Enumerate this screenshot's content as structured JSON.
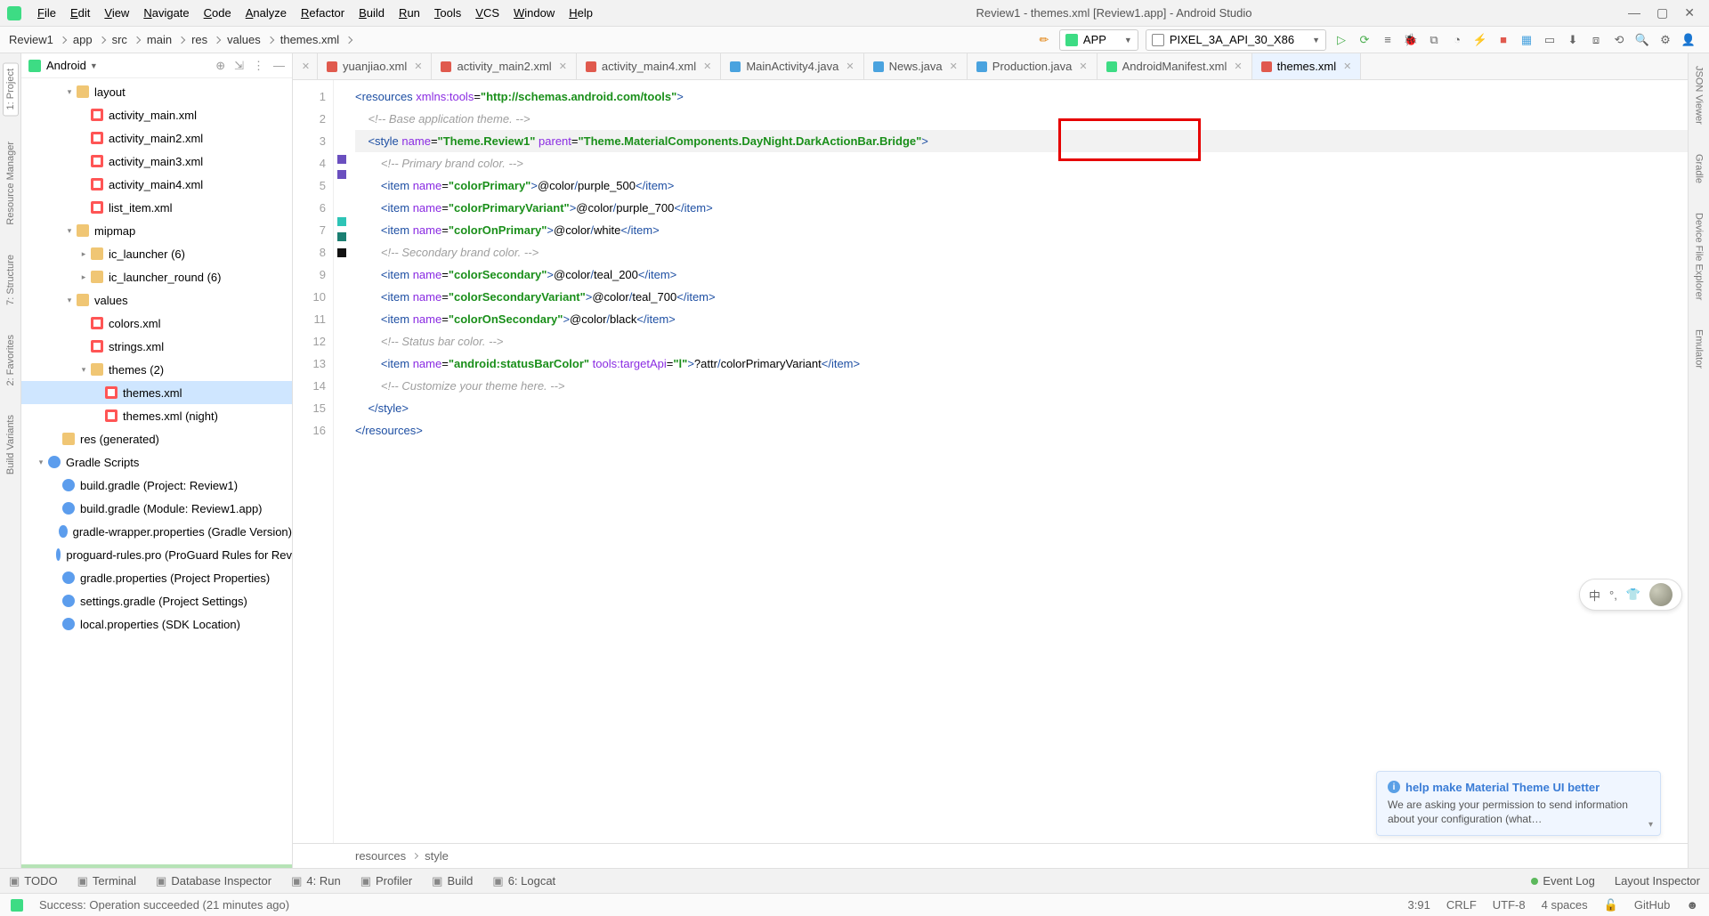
{
  "menu": [
    "File",
    "Edit",
    "View",
    "Navigate",
    "Code",
    "Analyze",
    "Refactor",
    "Build",
    "Run",
    "Tools",
    "VCS",
    "Window",
    "Help"
  ],
  "window_title": "Review1 - themes.xml [Review1.app] - Android Studio",
  "breadcrumbs": [
    "Review1",
    "app",
    "src",
    "main",
    "res",
    "values",
    "themes.xml"
  ],
  "run_config": {
    "app": "APP",
    "device": "PIXEL_3A_API_30_X86"
  },
  "project_panel": {
    "title": "Android",
    "tree": [
      {
        "d": 3,
        "t": "folder",
        "label": "layout",
        "expand": "▾"
      },
      {
        "d": 4,
        "t": "xml",
        "label": "activity_main.xml"
      },
      {
        "d": 4,
        "t": "xml",
        "label": "activity_main2.xml"
      },
      {
        "d": 4,
        "t": "xml",
        "label": "activity_main3.xml"
      },
      {
        "d": 4,
        "t": "xml",
        "label": "activity_main4.xml"
      },
      {
        "d": 4,
        "t": "xml",
        "label": "list_item.xml"
      },
      {
        "d": 3,
        "t": "folder",
        "label": "mipmap",
        "expand": "▾"
      },
      {
        "d": 4,
        "t": "folder",
        "label": "ic_launcher (6)",
        "expand": "▸"
      },
      {
        "d": 4,
        "t": "folder",
        "label": "ic_launcher_round (6)",
        "expand": "▸"
      },
      {
        "d": 3,
        "t": "folder",
        "label": "values",
        "expand": "▾"
      },
      {
        "d": 4,
        "t": "xml",
        "label": "colors.xml"
      },
      {
        "d": 4,
        "t": "xml",
        "label": "strings.xml"
      },
      {
        "d": 4,
        "t": "folder",
        "label": "themes (2)",
        "expand": "▾"
      },
      {
        "d": 5,
        "t": "xml",
        "label": "themes.xml",
        "selected": true
      },
      {
        "d": 5,
        "t": "xml",
        "label": "themes.xml (night)"
      },
      {
        "d": 2,
        "t": "folder",
        "label": "res (generated)"
      },
      {
        "d": 1,
        "t": "gradle",
        "label": "Gradle Scripts",
        "expand": "▾"
      },
      {
        "d": 2,
        "t": "gradle",
        "label": "build.gradle (Project: Review1)"
      },
      {
        "d": 2,
        "t": "gradle",
        "label": "build.gradle (Module: Review1.app)"
      },
      {
        "d": 2,
        "t": "gradle",
        "label": "gradle-wrapper.properties (Gradle Version)"
      },
      {
        "d": 2,
        "t": "gradle",
        "label": "proguard-rules.pro (ProGuard Rules for Rev"
      },
      {
        "d": 2,
        "t": "gradle",
        "label": "gradle.properties (Project Properties)"
      },
      {
        "d": 2,
        "t": "gradle",
        "label": "settings.gradle (Project Settings)"
      },
      {
        "d": 2,
        "t": "gradle",
        "label": "local.properties (SDK Location)"
      }
    ]
  },
  "tabs": [
    {
      "label": "yuanjiao.xml",
      "color": "#e05a4e"
    },
    {
      "label": "activity_main2.xml",
      "color": "#e05a4e"
    },
    {
      "label": "activity_main4.xml",
      "color": "#e05a4e"
    },
    {
      "label": "MainActivity4.java",
      "color": "#4aa3df"
    },
    {
      "label": "News.java",
      "color": "#4aa3df"
    },
    {
      "label": "Production.java",
      "color": "#4aa3df"
    },
    {
      "label": "AndroidManifest.xml",
      "color": "#3ddc84"
    },
    {
      "label": "themes.xml",
      "color": "#e05a4e",
      "active": true
    }
  ],
  "code_lines": [
    "<resources xmlns:tools=\"http://schemas.android.com/tools\">",
    "    <!-- Base application theme. -->",
    "    <style name=\"Theme.Review1\" parent=\"Theme.MaterialComponents.DayNight.DarkActionBar.Bridge\">",
    "        <!-- Primary brand color. -->",
    "        <item name=\"colorPrimary\">@color/purple_500</item>",
    "        <item name=\"colorPrimaryVariant\">@color/purple_700</item>",
    "        <item name=\"colorOnPrimary\">@color/white</item>",
    "        <!-- Secondary brand color. -->",
    "        <item name=\"colorSecondary\">@color/teal_200</item>",
    "        <item name=\"colorSecondaryVariant\">@color/teal_700</item>",
    "        <item name=\"colorOnSecondary\">@color/black</item>",
    "        <!-- Status bar color. -->",
    "        <item name=\"android:statusBarColor\" tools:targetApi=\"l\">?attr/colorPrimaryVariant</item>",
    "        <!-- Customize your theme here. -->",
    "    </style>",
    "</resources>"
  ],
  "gutter_marks": {
    "5": "#6a4fbf",
    "6": "#6a4fbf",
    "9": "#2ec4b6",
    "10": "#1b7f72",
    "11": "#111111"
  },
  "current_line": 3,
  "editor_crumbs": [
    "resources",
    "style"
  ],
  "notification": {
    "title": "help make Material Theme UI better",
    "body": "We are asking your permission to send information about your configuration (what…"
  },
  "bottom_tools": [
    "TODO",
    "Terminal",
    "Database Inspector",
    "4: Run",
    "Profiler",
    "Build",
    "6: Logcat"
  ],
  "bottom_right": [
    "Event Log",
    "Layout Inspector"
  ],
  "status": {
    "message": "Success: Operation succeeded (21 minutes ago)",
    "pos": "3:91",
    "eol": "CRLF",
    "enc": "UTF-8",
    "indent": "4 spaces",
    "branch": "GitHub"
  },
  "left_strip": [
    "1: Project",
    "Resource Manager",
    "7: Structure",
    "2: Favorites",
    "Build Variants"
  ],
  "right_strip": [
    "JSON Viewer",
    "Gradle",
    "Device File Explorer",
    "Emulator"
  ],
  "ime": [
    "中",
    "°,",
    "👕"
  ]
}
